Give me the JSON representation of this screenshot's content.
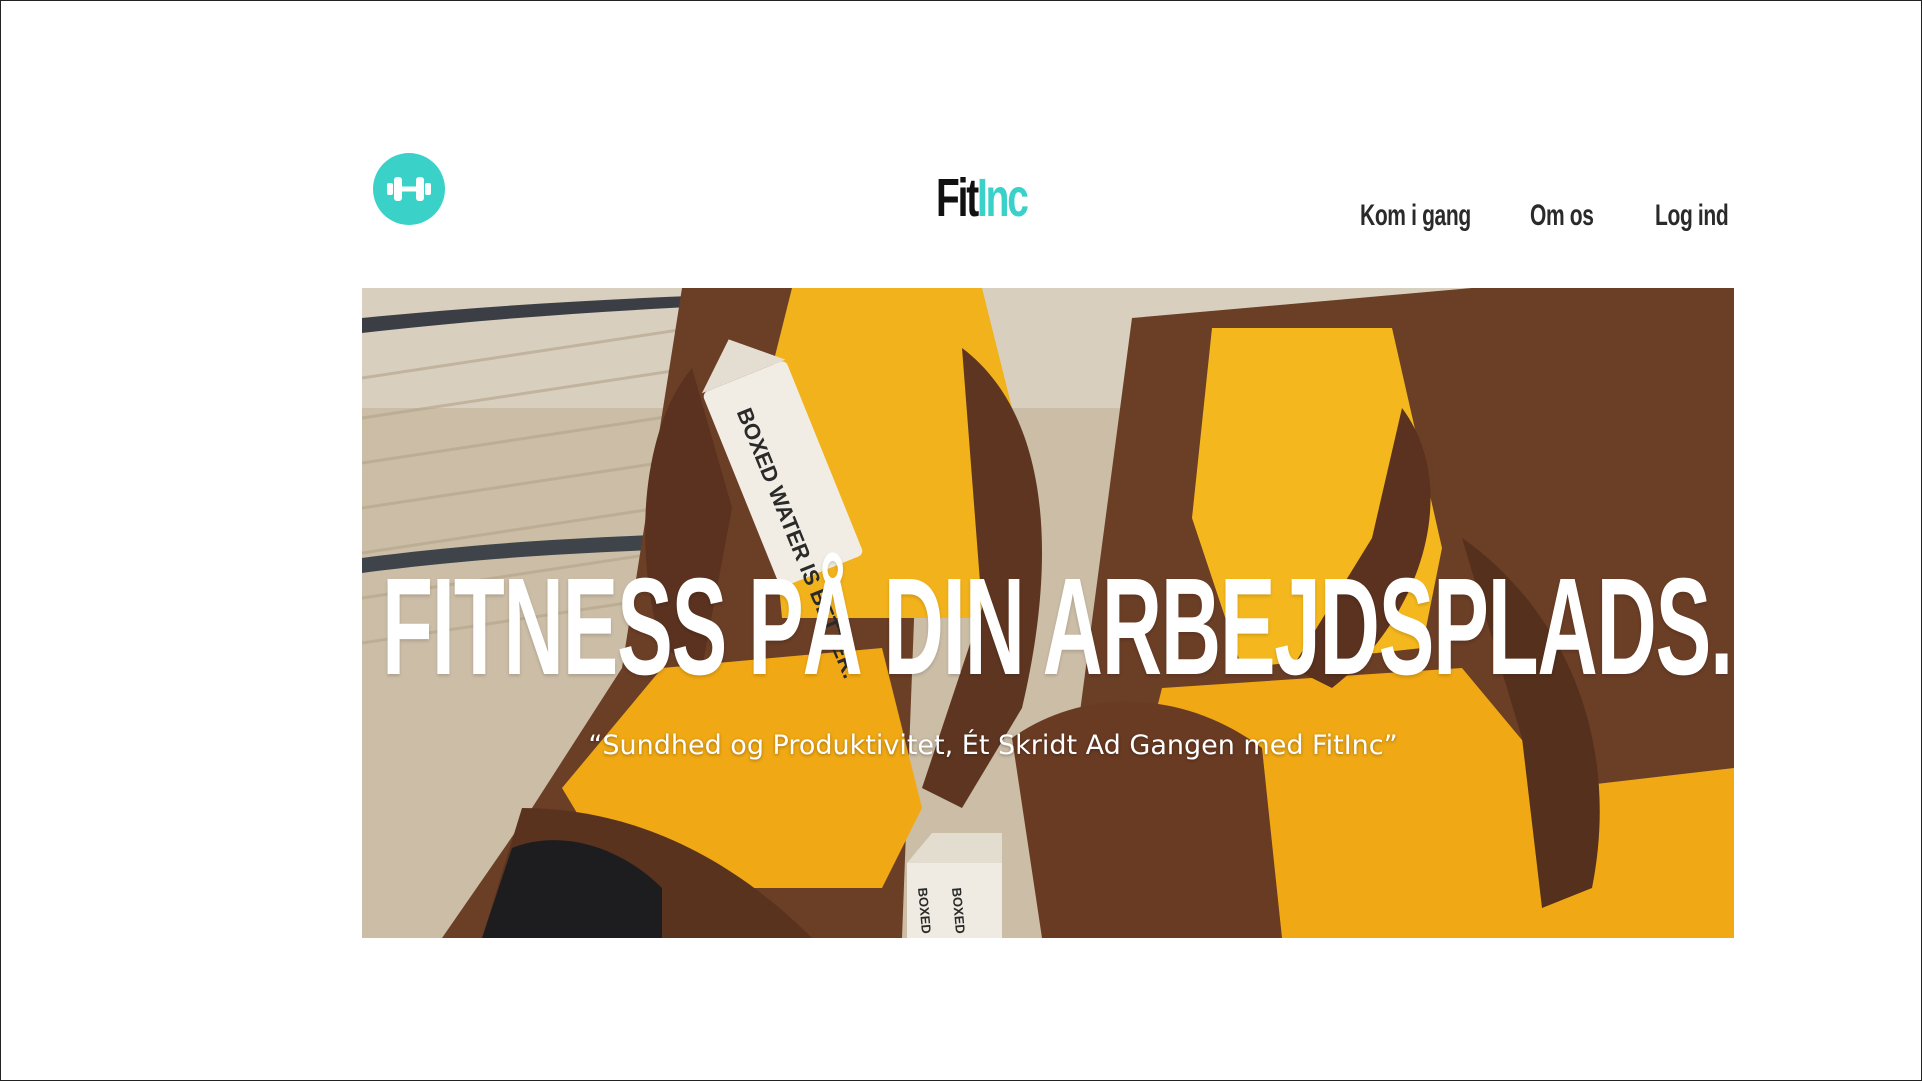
{
  "brand": {
    "name_part1": "Fit",
    "name_part2": "Inc",
    "accent_color": "#3ad1c9",
    "logo_icon": "dumbbell-icon"
  },
  "nav": {
    "items": [
      {
        "label": "Kom i gang"
      },
      {
        "label": "Om os"
      },
      {
        "label": "Log ind"
      }
    ]
  },
  "hero": {
    "headline": "FITNESS PÅ DIN ARBEJDSPLADS.",
    "tagline": "“Sundhed og Produktivitet, Ét Skridt Ad Gangen med FitInc”",
    "carton_text": "BOXED WATER IS BETTER."
  }
}
